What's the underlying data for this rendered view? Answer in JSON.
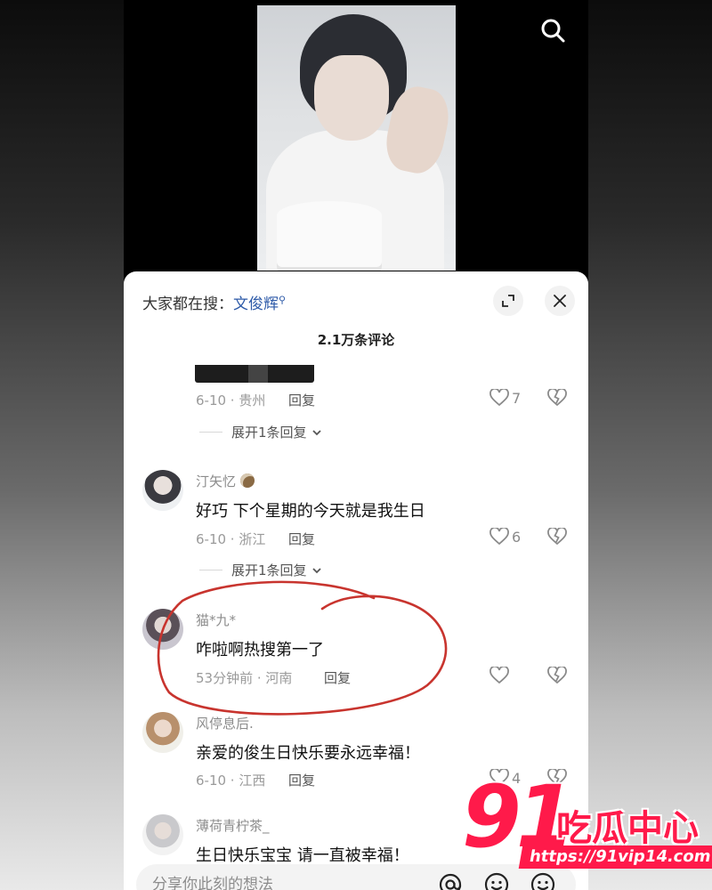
{
  "sheet": {
    "hot_search_prefix": "大家都在搜：",
    "hot_search_keyword": "文俊辉",
    "comment_count": "2.1万条评论"
  },
  "comments": [
    {
      "meta": "6-10 · 贵州",
      "reply_label": "回复",
      "likes": "7",
      "expand_label": "展开1条回复"
    },
    {
      "username": "汀矢忆",
      "text": "好巧 下个星期的今天就是我生日",
      "meta": "6-10 · 浙江",
      "reply_label": "回复",
      "likes": "6",
      "expand_label": "展开1条回复"
    },
    {
      "username": "猫*九*",
      "text": "咋啦啊热搜第一了",
      "meta": "53分钟前 · 河南",
      "reply_label": "回复",
      "likes": ""
    },
    {
      "username": "风停息后.",
      "text": "亲爱的俊生日快乐要永远幸福！",
      "meta": "6-10 · 江西",
      "reply_label": "回复",
      "likes": "4"
    },
    {
      "username": "薄荷青柠茶_",
      "text": "生日快乐宝宝 请一直被幸福！"
    }
  ],
  "composer": {
    "placeholder": "分享你此刻的想法"
  },
  "watermark": {
    "number": "91",
    "name": "吃瓜中心",
    "url": "https://91vip14.com"
  },
  "colors": {
    "keyword": "#2d5aa8",
    "annotation": "#c8342e",
    "watermark": "#ff1a4a"
  },
  "icons": [
    "search-icon",
    "expand-icon",
    "close-icon",
    "heart-icon",
    "broken-heart-icon",
    "chevron-down-icon",
    "at-icon",
    "emoji-icon"
  ]
}
